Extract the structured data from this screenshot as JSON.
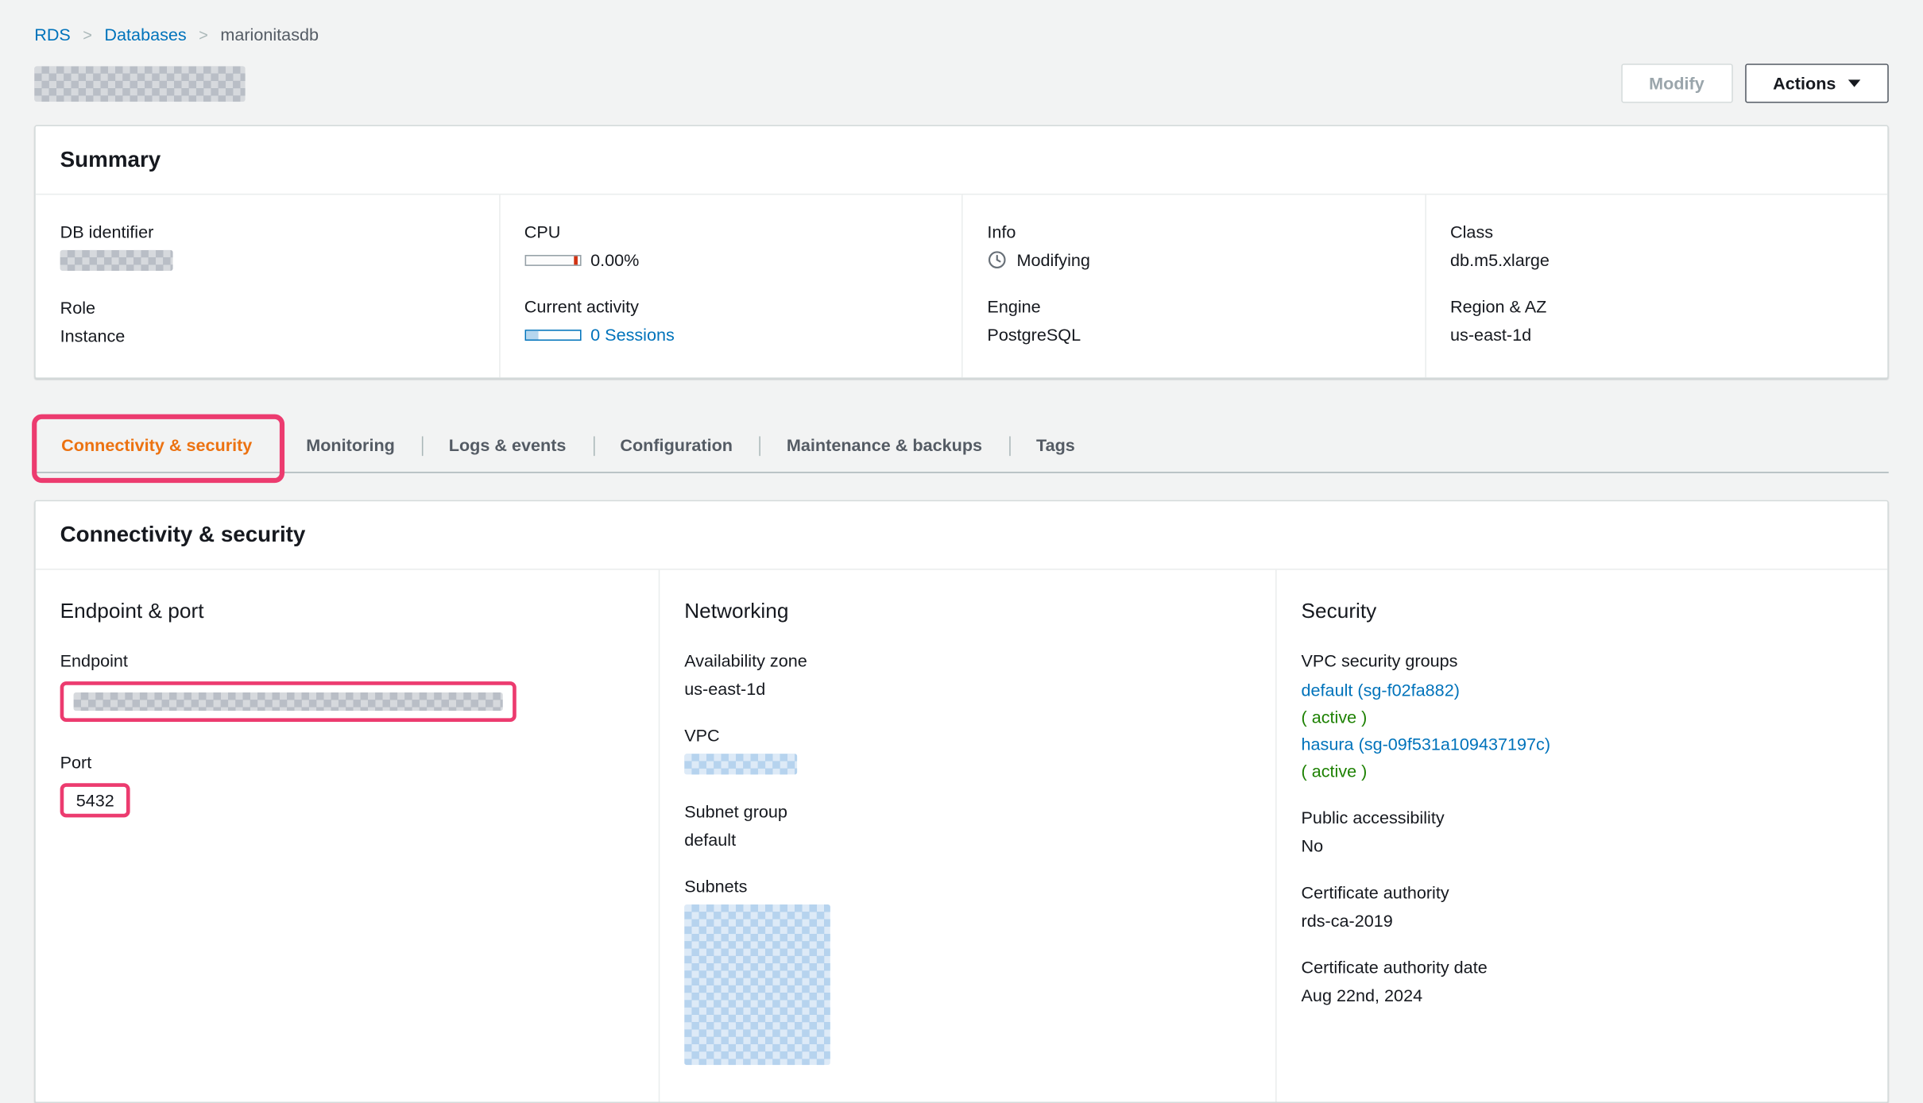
{
  "breadcrumb": {
    "items": [
      {
        "label": "RDS"
      },
      {
        "label": "Databases"
      },
      {
        "label": "marionitasdb"
      }
    ]
  },
  "header": {
    "modify_label": "Modify",
    "actions_label": "Actions"
  },
  "summary": {
    "title": "Summary",
    "db_identifier_label": "DB identifier",
    "role_label": "Role",
    "role_value": "Instance",
    "cpu_label": "CPU",
    "cpu_value": "0.00%",
    "current_activity_label": "Current activity",
    "current_activity_value": "0 Sessions",
    "info_label": "Info",
    "info_value": "Modifying",
    "engine_label": "Engine",
    "engine_value": "PostgreSQL",
    "class_label": "Class",
    "class_value": "db.m5.xlarge",
    "region_label": "Region & AZ",
    "region_value": "us-east-1d"
  },
  "tabs": [
    {
      "label": "Connectivity & security",
      "active": true
    },
    {
      "label": "Monitoring",
      "active": false
    },
    {
      "label": "Logs & events",
      "active": false
    },
    {
      "label": "Configuration",
      "active": false
    },
    {
      "label": "Maintenance & backups",
      "active": false
    },
    {
      "label": "Tags",
      "active": false
    }
  ],
  "connectivity": {
    "title": "Connectivity & security",
    "endpoint_port": {
      "title": "Endpoint & port",
      "endpoint_label": "Endpoint",
      "port_label": "Port",
      "port_value": "5432"
    },
    "networking": {
      "title": "Networking",
      "az_label": "Availability zone",
      "az_value": "us-east-1d",
      "vpc_label": "VPC",
      "subnet_group_label": "Subnet group",
      "subnet_group_value": "default",
      "subnets_label": "Subnets"
    },
    "security": {
      "title": "Security",
      "vpc_sg_label": "VPC security groups",
      "groups": [
        {
          "link": "default (sg-f02fa882)",
          "status": "( active )"
        },
        {
          "link": "hasura (sg-09f531a109437197c)",
          "status": "( active )"
        }
      ],
      "public_access_label": "Public accessibility",
      "public_access_value": "No",
      "ca_label": "Certificate authority",
      "ca_value": "rds-ca-2019",
      "ca_date_label": "Certificate authority date",
      "ca_date_value": "Aug 22nd, 2024"
    }
  },
  "redactions": {
    "page_title": true,
    "db_identifier_value": true,
    "endpoint_value": true,
    "vpc_value": true,
    "subnets_value": true
  },
  "colors": {
    "link_blue": "#0073bb",
    "active_tab_orange": "#ec7211",
    "status_green": "#1d8102",
    "annotation_pink": "#ec3b6f",
    "background": "#f2f3f3"
  }
}
